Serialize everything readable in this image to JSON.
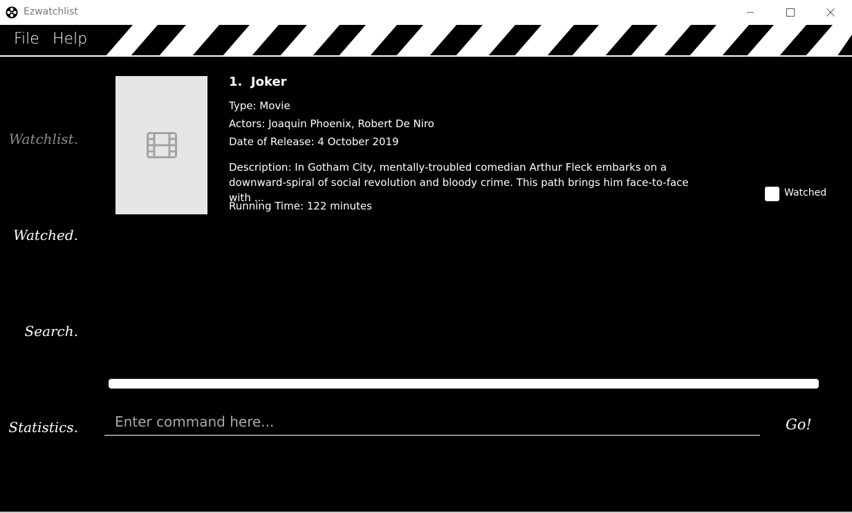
{
  "window": {
    "title": "Ezwatchlist",
    "icon": "film-reel-icon"
  },
  "menu": {
    "file": "File",
    "help": "Help"
  },
  "sidebar": {
    "items": [
      {
        "label": "Watchlist.",
        "active": true
      },
      {
        "label": "Watched.",
        "active": false
      },
      {
        "label": "Search.",
        "active": false
      },
      {
        "label": "Statistics.",
        "active": false
      }
    ]
  },
  "card": {
    "index": "1.",
    "title": "Joker",
    "type": "Type: Movie",
    "actors": "Actors:   Joaquin Phoenix, Robert De Niro",
    "release": "Date of Release: 4 October 2019",
    "description_line1": "Description: In Gotham City, mentally-troubled comedian Arthur Fleck embarks on a",
    "description_line2": "downward-spiral of social revolution and bloody crime. This path brings him face-to-face with ...",
    "running_time": "Running Time: 122 minutes",
    "watched_label": "Watched",
    "watched_checked": false,
    "poster_icon": "film-icon"
  },
  "command": {
    "placeholder": "Enter command here...",
    "go_label": "Go!"
  },
  "colors": {
    "background": "#000000",
    "sidebar_active": "#8a8a8a",
    "poster_placeholder": "#e6e6e6"
  }
}
